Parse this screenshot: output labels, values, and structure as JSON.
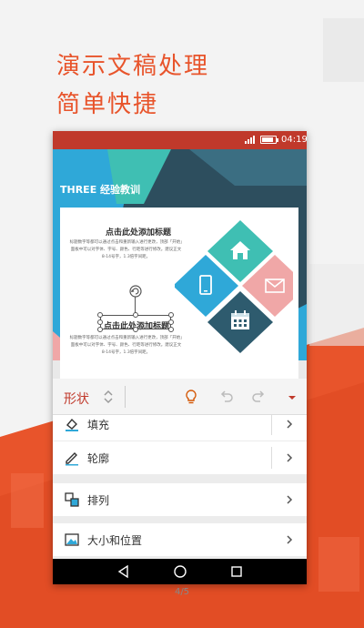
{
  "promo": {
    "line1": "演示文稿处理",
    "line2": "简单快捷"
  },
  "status_bar": {
    "time": "04:19",
    "battery_level": 0.85
  },
  "slide": {
    "title": "THREE 经验教训",
    "heading_1": "点击此处添加标题",
    "text_1": "标题数字等都可以通过点击和重新输入进行更改，顶部「开始」面板中可以对字体、字号、颜色、行距等进行修改。建议正文8-14号字，1.3倍字间距。",
    "heading_2": "点击此处添加标题",
    "text_2": "标题数字等都可以通过点击和重新输入进行更改，顶部「开始」面板中可以对字体、字号、颜色、行距等进行修改。建议正文8-14号字，1.3倍字间距。",
    "diamond_icons": [
      "home-icon",
      "phone-icon",
      "mail-icon",
      "calendar-icon"
    ],
    "colors": {
      "teal": "#3fbfb3",
      "blue": "#2fa8d8",
      "pink": "#f0a7a7",
      "dark": "#2e5b6e"
    }
  },
  "toolbar": {
    "label": "形状"
  },
  "menu": {
    "items": [
      {
        "label": "填充",
        "icon": "fill-bucket-icon"
      },
      {
        "label": "轮廓",
        "icon": "pen-outline-icon"
      },
      {
        "label": "排列",
        "icon": "arrange-icon"
      },
      {
        "label": "大小和位置",
        "icon": "image-icon"
      }
    ]
  },
  "pager": {
    "text": "4/5"
  },
  "colors": {
    "accent": "#e8542b",
    "status_bar": "#c0392b"
  }
}
